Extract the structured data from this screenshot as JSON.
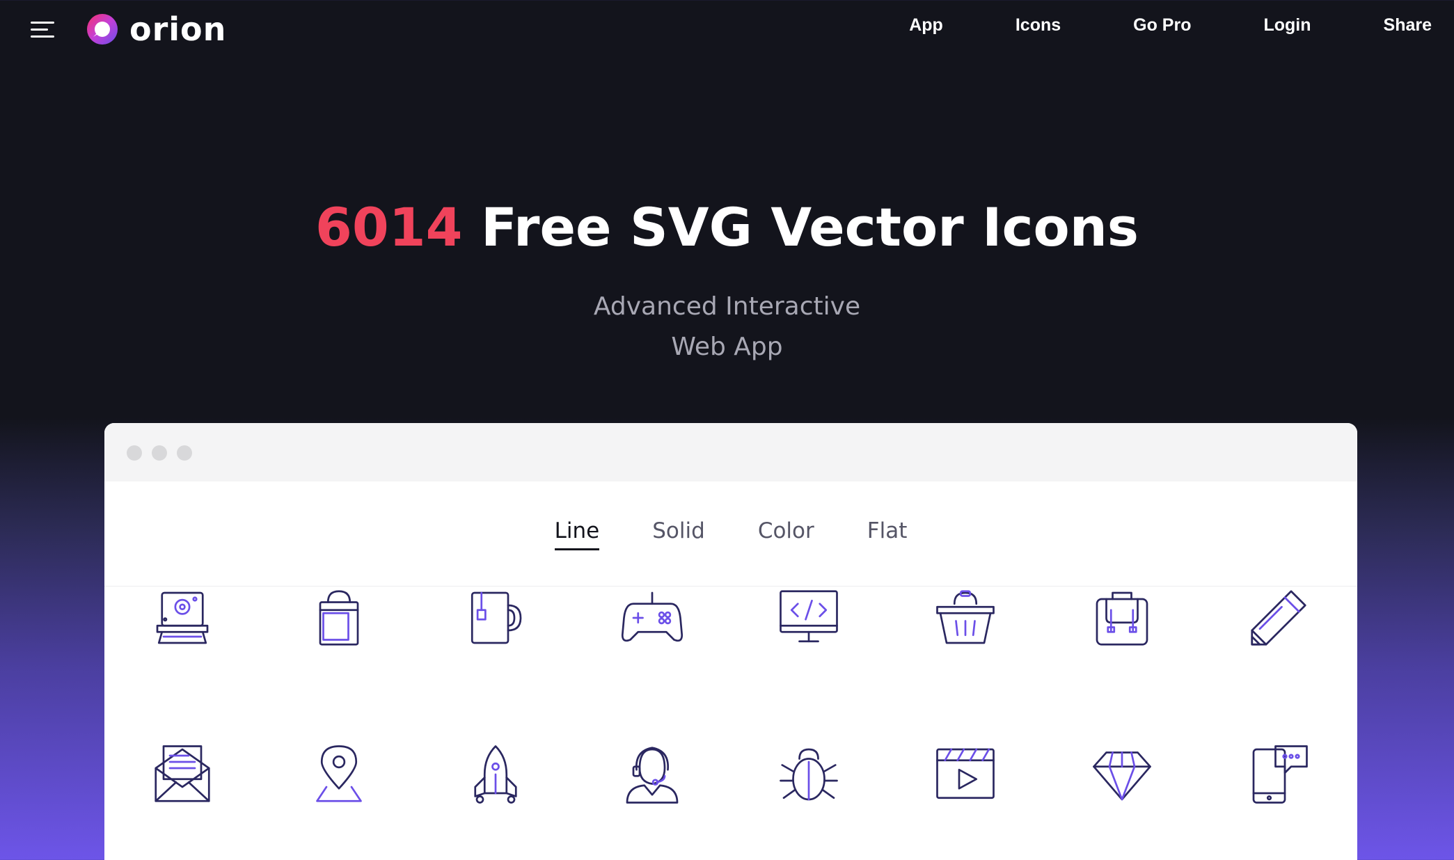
{
  "header": {
    "logo_text": "orion",
    "nav": [
      {
        "label": "App"
      },
      {
        "label": "Icons"
      },
      {
        "label": "Go Pro"
      },
      {
        "label": "Login"
      },
      {
        "label": "Share"
      }
    ]
  },
  "hero": {
    "count": "6014",
    "title_rest": " Free SVG Vector Icons",
    "subtitle_line1": "Advanced Interactive",
    "subtitle_line2": "Web App"
  },
  "tabs": [
    {
      "label": "Line",
      "active": true
    },
    {
      "label": "Solid",
      "active": false
    },
    {
      "label": "Color",
      "active": false
    },
    {
      "label": "Flat",
      "active": false
    }
  ],
  "icons": [
    "printer-icon",
    "shopping-bag-icon",
    "mug-icon",
    "gamepad-icon",
    "code-monitor-icon",
    "basket-icon",
    "backpack-icon",
    "pencil-icon",
    "mail-open-icon",
    "map-pin-icon",
    "rocket-icon",
    "support-agent-icon",
    "bug-icon",
    "video-player-icon",
    "diamond-icon",
    "phone-chat-icon"
  ],
  "colors": {
    "background": "#13141c",
    "accent_count": "#f0435b",
    "icon_dark": "#2a2760",
    "icon_purple": "#6b4fe8"
  }
}
